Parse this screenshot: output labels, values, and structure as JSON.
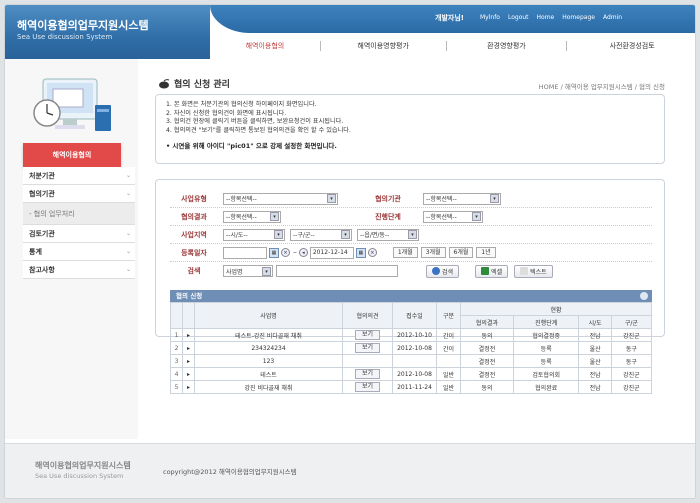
{
  "header": {
    "logo_title": "해역이용협의업무지원시스템",
    "logo_sub": "Sea Use discussion System",
    "welcome": "개발자님!",
    "top_links": [
      "Mylnfo",
      "Logout",
      "Home",
      "Homepage",
      "Admin"
    ],
    "gnb": [
      "해역이용협의",
      "해역이용영향평가",
      "환경영향평가",
      "사전환경성검토"
    ],
    "gnb_active": "해역이용협의"
  },
  "sidebar": {
    "title": "해역이용협의",
    "items": [
      {
        "label": "처분기관",
        "sub": false
      },
      {
        "label": "협의기관",
        "sub": false
      },
      {
        "label": "- 협의 업무처리",
        "sub": true
      },
      {
        "label": "검토기관",
        "sub": false
      },
      {
        "label": "통계",
        "sub": false
      },
      {
        "label": "참고사항",
        "sub": false
      }
    ]
  },
  "page": {
    "title": "협의 신청 관리",
    "breadcrumb": "HOME / 해역이용 업무지원시스템 / 협의 신청"
  },
  "notice": {
    "lines": [
      "1. 본 화면은 처분기관의 협의신청 하이페이지 화면입니다.",
      "2. 자신이 신청한 협의건이 화면에 표시됩니다.",
      "3. 협의건 현장에 클릭기 버튼을 클릭하면, 보완요청건이 표시됩니다.",
      "4. 협의의견 \"보기\"를 클릭하면 통보된 협의의견을 확인 할 수 있습니다."
    ],
    "emphasis": "• 시연을 위해 아이디 \"pic01\" 으로 강제 설정한 화면입니다."
  },
  "search": {
    "labels": {
      "biz_type": "사업유형",
      "agency": "협의기관",
      "result": "협의결과",
      "stage": "진행단계",
      "region": "사업지역",
      "date": "등록일자",
      "keyword": "검색"
    },
    "select_placeholder": "--항목선택--",
    "region_sido": "--시/도--",
    "region_gugun": "--구/군--",
    "region_dong": "--읍/면/동--",
    "date_end": "2012-12-14",
    "periods": [
      "1개월",
      "3개월",
      "6개월",
      "1년"
    ],
    "keyword_field": "사업명",
    "buttons": {
      "search": "검색",
      "excel": "엑셀",
      "text": "텍스트"
    }
  },
  "results": {
    "title": "협의 신청",
    "headers": {
      "biz": "사업명",
      "opinion": "협의의견",
      "received": "접수일",
      "category": "구분",
      "status": "현황",
      "status_sub": [
        "협의결과",
        "진행단계",
        "시/도",
        "구/군"
      ]
    },
    "rows": [
      {
        "n": "1",
        "name": "테스트-강진 비다골재 채취",
        "opinion": "보기",
        "date": "2012-10-10",
        "cat": "간이",
        "result": "동의",
        "stage": "협의결정중",
        "sido": "전남",
        "gugun": "강진군"
      },
      {
        "n": "2",
        "name": "234324234",
        "opinion": "보기",
        "date": "2012-10-08",
        "cat": "간이",
        "result": "결정전",
        "stage": "등록",
        "sido": "울산",
        "gugun": "동구"
      },
      {
        "n": "3",
        "name": "123",
        "opinion": "",
        "date": "",
        "cat": "",
        "result": "결정전",
        "stage": "등록",
        "sido": "울산",
        "gugun": "동구"
      },
      {
        "n": "4",
        "name": "테스트",
        "opinion": "보기",
        "date": "2012-10-08",
        "cat": "일반",
        "result": "결정전",
        "stage": "검토협의회",
        "sido": "전남",
        "gugun": "강진군"
      },
      {
        "n": "5",
        "name": "강진 비다골재 채취",
        "opinion": "보기",
        "date": "2011-11-24",
        "cat": "일반",
        "result": "동의",
        "stage": "협의완료",
        "sido": "전남",
        "gugun": "강진군"
      }
    ]
  },
  "footer": {
    "title": "해역이용협의업무지원시스템",
    "sub": "Sea Use discussion System",
    "copyright": "copyright@2012 해역이용협의업무지원시스템"
  }
}
